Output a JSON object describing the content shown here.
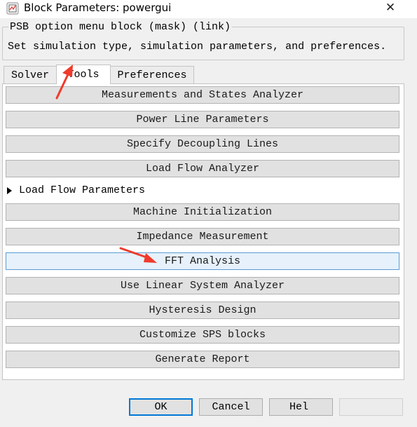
{
  "window": {
    "title": "Block Parameters: powergui",
    "close_glyph": "✕"
  },
  "mask": {
    "title": "PSB option menu block (mask) (link)",
    "description": "Set simulation type, simulation parameters, and preferences."
  },
  "tabs": [
    {
      "label": "Solver",
      "active": false
    },
    {
      "label": "Tools",
      "active": true
    },
    {
      "label": "Preferences",
      "active": false
    }
  ],
  "tools": {
    "buttons": [
      {
        "label": "Measurements and States Analyzer"
      },
      {
        "label": "Power Line Parameters"
      },
      {
        "label": "Specify Decoupling Lines"
      },
      {
        "label": "Load Flow Analyzer"
      },
      {
        "label": "Machine Initialization"
      },
      {
        "label": "Impedance Measurement"
      },
      {
        "label": "FFT Analysis",
        "focused": true
      },
      {
        "label": "Use Linear System Analyzer"
      },
      {
        "label": "Hysteresis Design"
      },
      {
        "label": "Customize SPS blocks"
      },
      {
        "label": "Generate Report"
      }
    ],
    "collapsible_section": {
      "label": "Load Flow Parameters",
      "expanded": false
    }
  },
  "footer": {
    "ok_label": "OK",
    "cancel_label": "Cancel",
    "help_label": "Hel",
    "apply_label": "",
    "apply_enabled": false
  },
  "colors": {
    "annotation_arrow": "#f03a2c",
    "focus_border": "#5b9bd5",
    "default_button_border": "#0078d7"
  },
  "icons": {
    "app": "simulink-block-icon",
    "close": "close-icon",
    "expand": "triangle-right-icon"
  }
}
